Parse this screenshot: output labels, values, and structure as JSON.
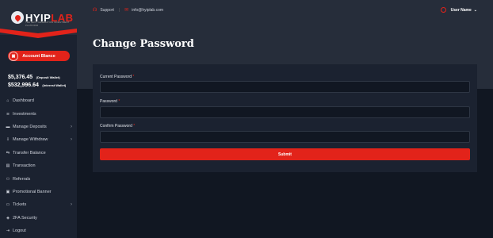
{
  "logo": {
    "part1": "HYIP",
    "part2": "LAB",
    "tagline": "THE NEXT GENERATION INVESTMENT PLATFORM"
  },
  "colors": {
    "accent": "#e2231a",
    "sidebar_bg": "#1b2230",
    "header_bg": "#262d3a",
    "page_bg": "#111722"
  },
  "sidebar": {
    "account_button": "Account Blance",
    "balances": [
      {
        "amount": "$5,376.45",
        "label": "(Deposit Wallet)"
      },
      {
        "amount": "$532,996.64",
        "label": "(Interest Wallet)"
      }
    ],
    "items": [
      {
        "label": "Dashboard",
        "icon": "home-icon",
        "glyph": "⌂",
        "chevron": false
      },
      {
        "label": "Investments",
        "icon": "layers-icon",
        "glyph": "≋",
        "chevron": false
      },
      {
        "label": "Manage Deposits",
        "icon": "wallet-icon",
        "glyph": "▬",
        "chevron": true
      },
      {
        "label": "Manage Withdraw",
        "icon": "withdraw-icon",
        "glyph": "⇩",
        "chevron": true
      },
      {
        "label": "Transfer Balance",
        "icon": "transfer-icon",
        "glyph": "⇆",
        "chevron": false
      },
      {
        "label": "Transaction",
        "icon": "transaction-icon",
        "glyph": "▤",
        "chevron": false
      },
      {
        "label": "Referrals",
        "icon": "users-icon",
        "glyph": "⚇",
        "chevron": false
      },
      {
        "label": "Promotional Banner",
        "icon": "image-icon",
        "glyph": "▣",
        "chevron": false
      },
      {
        "label": "Tickets",
        "icon": "ticket-icon",
        "glyph": "▭",
        "chevron": true
      },
      {
        "label": "2FA Security",
        "icon": "shield-icon",
        "glyph": "◈",
        "chevron": false
      },
      {
        "label": "Logout",
        "icon": "logout-icon",
        "glyph": "⇥",
        "chevron": false
      }
    ]
  },
  "header": {
    "support": "Support",
    "email": "info@hyiplab.com",
    "user_name": "User Name"
  },
  "page": {
    "title": "Change Password"
  },
  "form": {
    "fields": [
      {
        "label": "Current Password",
        "value": ""
      },
      {
        "label": "Password",
        "value": ""
      },
      {
        "label": "Confirm Password",
        "value": ""
      }
    ],
    "required_mark": "*",
    "submit": "Submit"
  }
}
